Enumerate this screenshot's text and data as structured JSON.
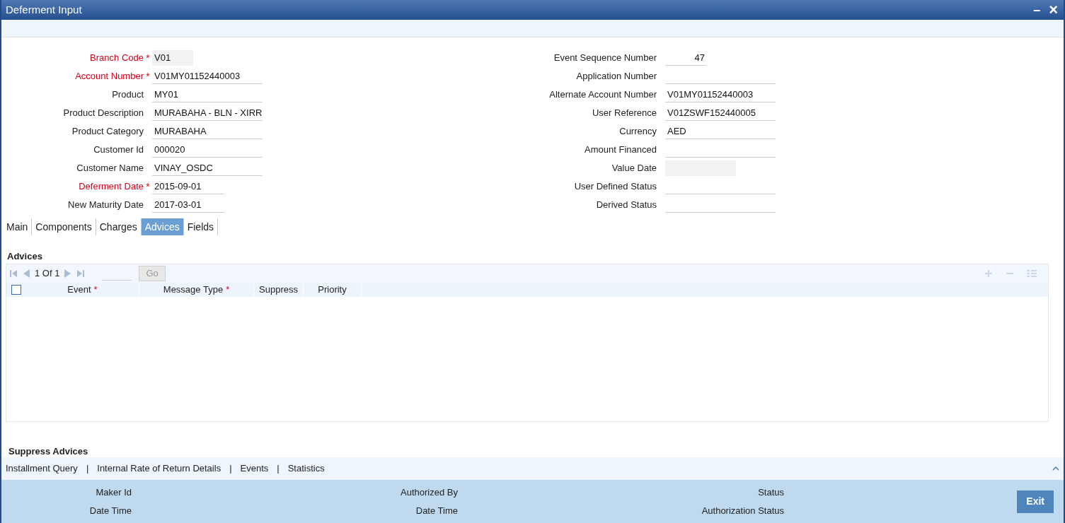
{
  "window": {
    "title": "Deferment Input",
    "minimize": "–",
    "close": "×"
  },
  "required_mark": "*",
  "left_fields": [
    {
      "label": "Branch Code",
      "required": true,
      "kind": "code",
      "value": "V01"
    },
    {
      "label": "Account Number",
      "required": true,
      "kind": "text",
      "value": "V01MY01152440003"
    },
    {
      "label": "Product",
      "required": false,
      "kind": "text",
      "value": "MY01"
    },
    {
      "label": "Product Description",
      "required": false,
      "kind": "text",
      "value": "MURABAHA - BLN - XIRR"
    },
    {
      "label": "Product Category",
      "required": false,
      "kind": "text",
      "value": "MURABAHA"
    },
    {
      "label": "Customer Id",
      "required": false,
      "kind": "text",
      "value": "000020"
    },
    {
      "label": "Customer Name",
      "required": false,
      "kind": "text",
      "value": "VINAY_OSDC"
    },
    {
      "label": "Deferment Date",
      "required": true,
      "kind": "date",
      "value": "2015-09-01"
    },
    {
      "label": "New Maturity Date",
      "required": false,
      "kind": "date",
      "value": "2017-03-01"
    }
  ],
  "right_fields": [
    {
      "label": "Event Sequence Number",
      "required": false,
      "kind": "number",
      "value": "47"
    },
    {
      "label": "Application Number",
      "required": false,
      "kind": "text"
    },
    {
      "label": "Alternate Account Number",
      "required": false,
      "kind": "text",
      "value": "V01MY01152440003"
    },
    {
      "label": "User Reference",
      "required": false,
      "kind": "text",
      "value": "V01ZSWF152440005"
    },
    {
      "label": "Currency",
      "required": false,
      "kind": "text",
      "value": "AED"
    },
    {
      "label": "Amount Financed",
      "required": false,
      "kind": "text"
    },
    {
      "label": "Value Date",
      "required": false,
      "kind": "code"
    },
    {
      "label": "User Defined Status",
      "required": false,
      "kind": "text"
    },
    {
      "label": "Derived Status",
      "required": false,
      "kind": "text"
    }
  ],
  "tabs": [
    {
      "label": "Main",
      "selected": false
    },
    {
      "label": "Components",
      "selected": false
    },
    {
      "label": "Charges",
      "selected": false
    },
    {
      "label": "Advices",
      "selected": true
    },
    {
      "label": "Fields",
      "selected": false
    }
  ],
  "advices": {
    "title": "Advices",
    "pager": "1 Of 1",
    "go": "Go",
    "select_all": {
      "checked": false
    },
    "columns": [
      {
        "label": "Event",
        "required": true
      },
      {
        "label": "Message Type",
        "required": true
      },
      {
        "label": "Suppress",
        "required": false
      },
      {
        "label": "Priority",
        "required": false
      }
    ]
  },
  "suppress_title": "Suppress Advices",
  "links": [
    "Installment Query",
    "Internal Rate of Return Details",
    "Events",
    "Statistics"
  ],
  "link_separator": "|",
  "footer": {
    "columns": [
      [
        "Maker Id",
        "Date Time"
      ],
      [
        "Authorized By",
        "Date Time"
      ],
      [
        "Status",
        "Authorization Status"
      ]
    ],
    "exit": "Exit"
  }
}
